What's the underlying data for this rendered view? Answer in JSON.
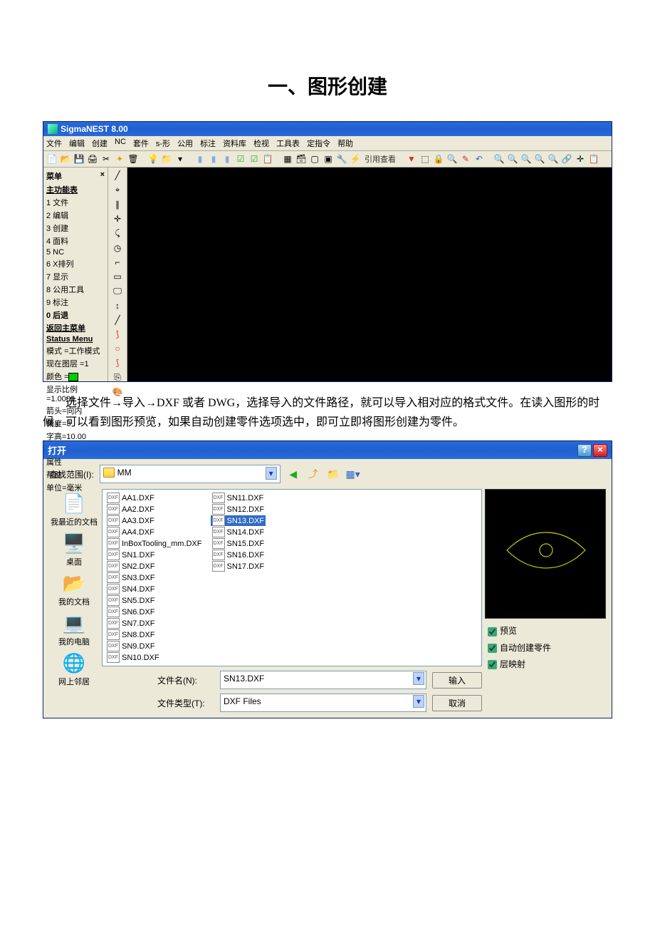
{
  "heading": "一、图形创建",
  "app": {
    "title": "SigmaNEST 8.00",
    "menus": [
      "文件",
      "编辑",
      "创建",
      "NC",
      "套件",
      "s-形",
      "公用",
      "标注",
      "资料库",
      "检视",
      "工具表",
      "定指令",
      "帮助"
    ],
    "toolbar_quote_text": "引用查看",
    "side": {
      "header": "菜单",
      "close": "×",
      "main_label": "主功能表",
      "items": [
        "1 文件",
        "2 编辑",
        "3 创建",
        "4 面料",
        "5 NC",
        "6 X排列",
        "7 显示",
        "8 公用工具",
        "9 标注"
      ],
      "back": "0 后退",
      "back_main": "返回主菜单",
      "status_label": "Status Menu",
      "status_items": [
        "模式 =工作模式",
        "现在图层 =1"
      ],
      "color_label": "颜色 =",
      "status_items2": [
        "显示比例=1.0000",
        "箭头=向内",
        "精度=3",
        "字高=10.00"
      ],
      "props": [
        "属性",
        "帮助",
        "单位=毫米"
      ]
    }
  },
  "paragraph": "选择文件→导入→DXF 或者 DWG，选择导入的文件路径，就可以导入相对应的格式文件。在读入图形的时候，可以看到图形预览，如果自动创建零件选项选中，即可立即将图形创建为零件。",
  "dialog": {
    "title": "打开",
    "look_in_label": "查找范围(I):",
    "folder": "MM",
    "places": [
      {
        "icon": "🕘",
        "label": "我最近的文档"
      },
      {
        "icon": "🖥️",
        "label": "桌面"
      },
      {
        "icon": "📁",
        "label": "我的文档"
      },
      {
        "icon": "💻",
        "label": "我的电脑"
      },
      {
        "icon": "🌐",
        "label": "网上邻居"
      }
    ],
    "files_col1": [
      "AA1.DXF",
      "AA2.DXF",
      "AA3.DXF",
      "AA4.DXF",
      "InBoxTooling_mm.DXF",
      "SN1.DXF",
      "SN2.DXF",
      "SN3.DXF",
      "SN4.DXF",
      "SN5.DXF",
      "SN6.DXF",
      "SN7.DXF",
      "SN8.DXF",
      "SN9.DXF",
      "SN10.DXF"
    ],
    "files_col2": [
      "SN11.DXF",
      "SN12.DXF",
      "SN13.DXF",
      "SN14.DXF",
      "SN15.DXF",
      "SN16.DXF",
      "SN17.DXF"
    ],
    "selected_file": "SN13.DXF",
    "checks": {
      "preview": "预览",
      "auto": "自动创建零件",
      "layer": "层映射"
    },
    "filename_label": "文件名(N):",
    "filename_value": "SN13.DXF",
    "filetype_label": "文件类型(T):",
    "filetype_value": "DXF Files",
    "btn_open": "输入",
    "btn_cancel": "取消"
  }
}
